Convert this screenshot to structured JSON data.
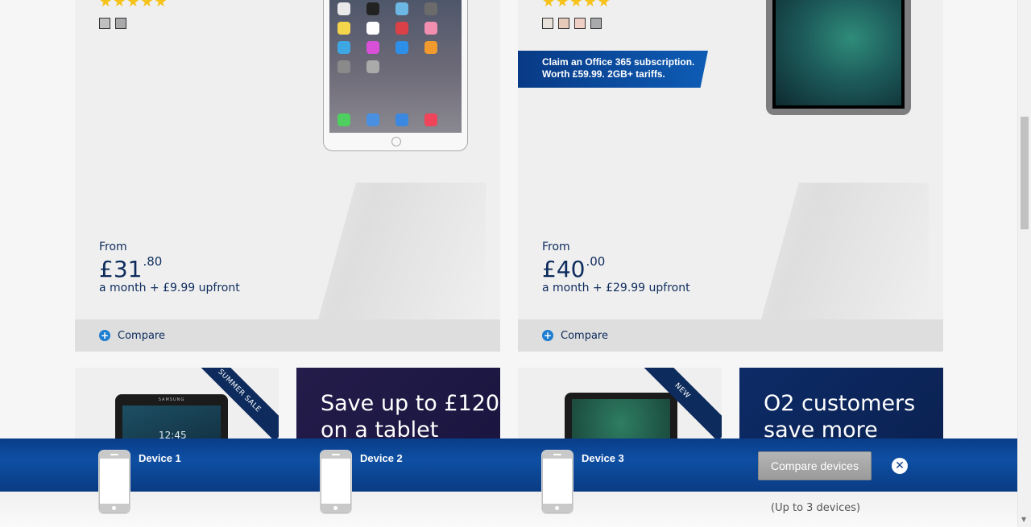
{
  "cards": [
    {
      "colors": [
        "#c0c0c0",
        "#a9a9ab"
      ],
      "price": {
        "from": "From",
        "main": "£31",
        "decimal": ".80",
        "sub": "a month + £9.99 upfront"
      },
      "compare_label": "Compare"
    },
    {
      "colors": [
        "#e8e2da",
        "#e5cbb8",
        "#f0cfc6",
        "#a9aaab"
      ],
      "promo": {
        "line1": "Claim an Office 365 subscription.",
        "line2": "Worth £59.99. 2GB+ tariffs."
      },
      "price": {
        "from": "From",
        "main": "£40",
        "decimal": ".00",
        "sub": "a month + £29.99 upfront"
      },
      "compare_label": "Compare"
    }
  ],
  "tiles": [
    {
      "ribbon": "SUMMER SALE",
      "brand": "SAMSUNG",
      "time": "12:45"
    },
    {
      "headline_line1": "Save up to £120",
      "headline_line2": "on a tablet"
    },
    {
      "ribbon": "NEW"
    },
    {
      "headline_line1": "O2 customers",
      "headline_line2": "save more"
    }
  ],
  "compare_bar": {
    "slots": [
      "Device 1",
      "Device 2",
      "Device 3"
    ],
    "button_label": "Compare devices",
    "note": "(Up to 3 devices)"
  }
}
